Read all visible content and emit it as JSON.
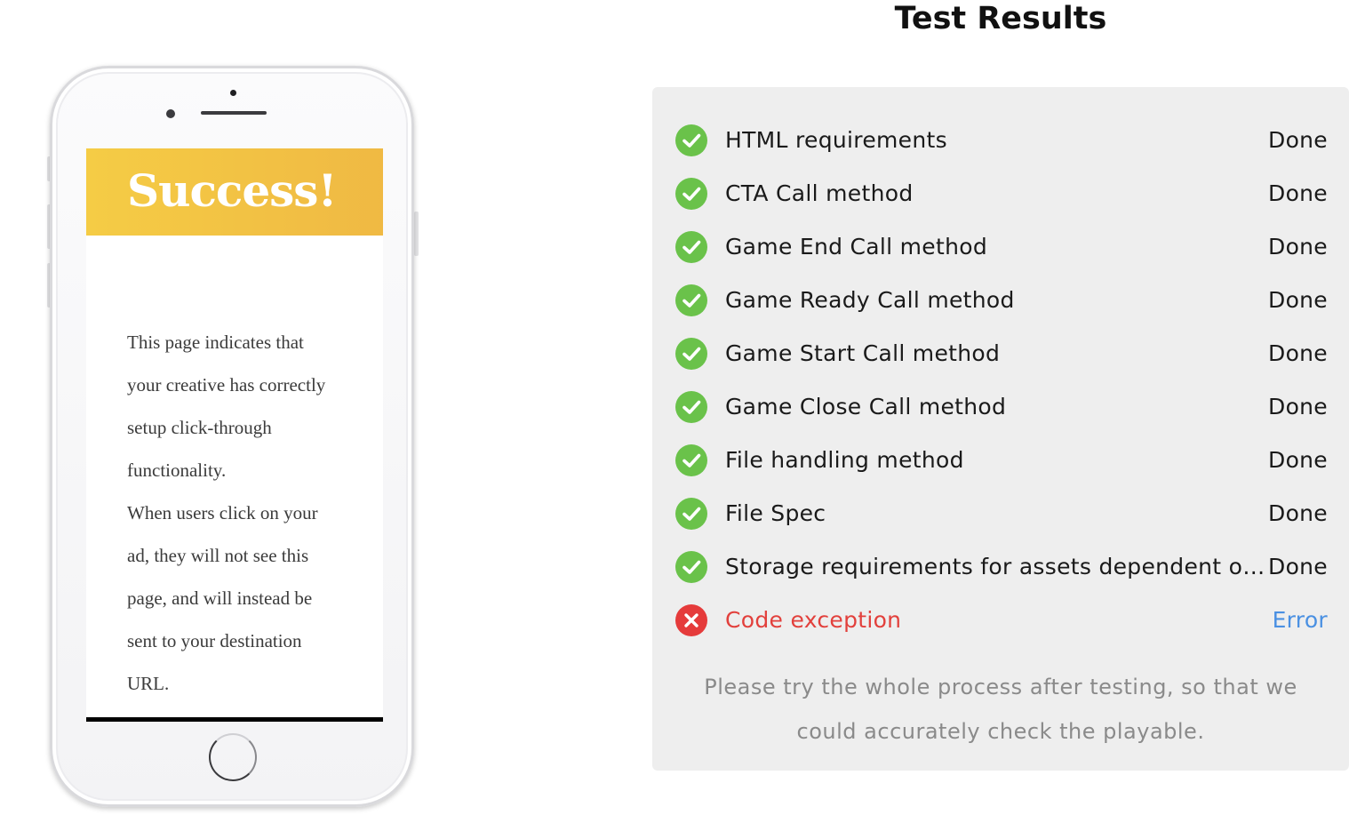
{
  "phone_preview": {
    "banner_title": "Success!",
    "body_lines": [
      "This page indicates that",
      "your creative has correctly",
      "setup click-through",
      "functionality.",
      "When users click on your",
      "ad, they will not see this",
      "page, and will instead be",
      "sent to your destination",
      "URL."
    ],
    "banner_colors": [
      "#f5cc45",
      "#efb743"
    ]
  },
  "results": {
    "title": "Test Results",
    "items": [
      {
        "name": "HTML requirements",
        "status": "Done",
        "state": "ok",
        "icon": "check-circle-icon"
      },
      {
        "name": "CTA Call method",
        "status": "Done",
        "state": "ok",
        "icon": "check-circle-icon"
      },
      {
        "name": "Game End Call method",
        "status": "Done",
        "state": "ok",
        "icon": "check-circle-icon"
      },
      {
        "name": "Game Ready Call method",
        "status": "Done",
        "state": "ok",
        "icon": "check-circle-icon"
      },
      {
        "name": "Game Start Call method",
        "status": "Done",
        "state": "ok",
        "icon": "check-circle-icon"
      },
      {
        "name": "Game Close Call method",
        "status": "Done",
        "state": "ok",
        "icon": "check-circle-icon"
      },
      {
        "name": "File handling method",
        "status": "Done",
        "state": "ok",
        "icon": "check-circle-icon"
      },
      {
        "name": "File Spec",
        "status": "Done",
        "state": "ok",
        "icon": "check-circle-icon"
      },
      {
        "name": "Storage requirements for assets dependent on...",
        "status": "Done",
        "state": "ok",
        "icon": "check-circle-icon"
      },
      {
        "name": "Code exception",
        "status": "Error",
        "state": "error",
        "icon": "error-circle-icon"
      }
    ],
    "note_lines": [
      "Please try the whole process after testing, so that we",
      "could accurately check the playable."
    ],
    "colors": {
      "ok": "#6ac24a",
      "error": "#e53b3b",
      "error_text": "#e2403c",
      "error_status": "#4a90e2",
      "panel_bg": "#eeeeee"
    }
  }
}
